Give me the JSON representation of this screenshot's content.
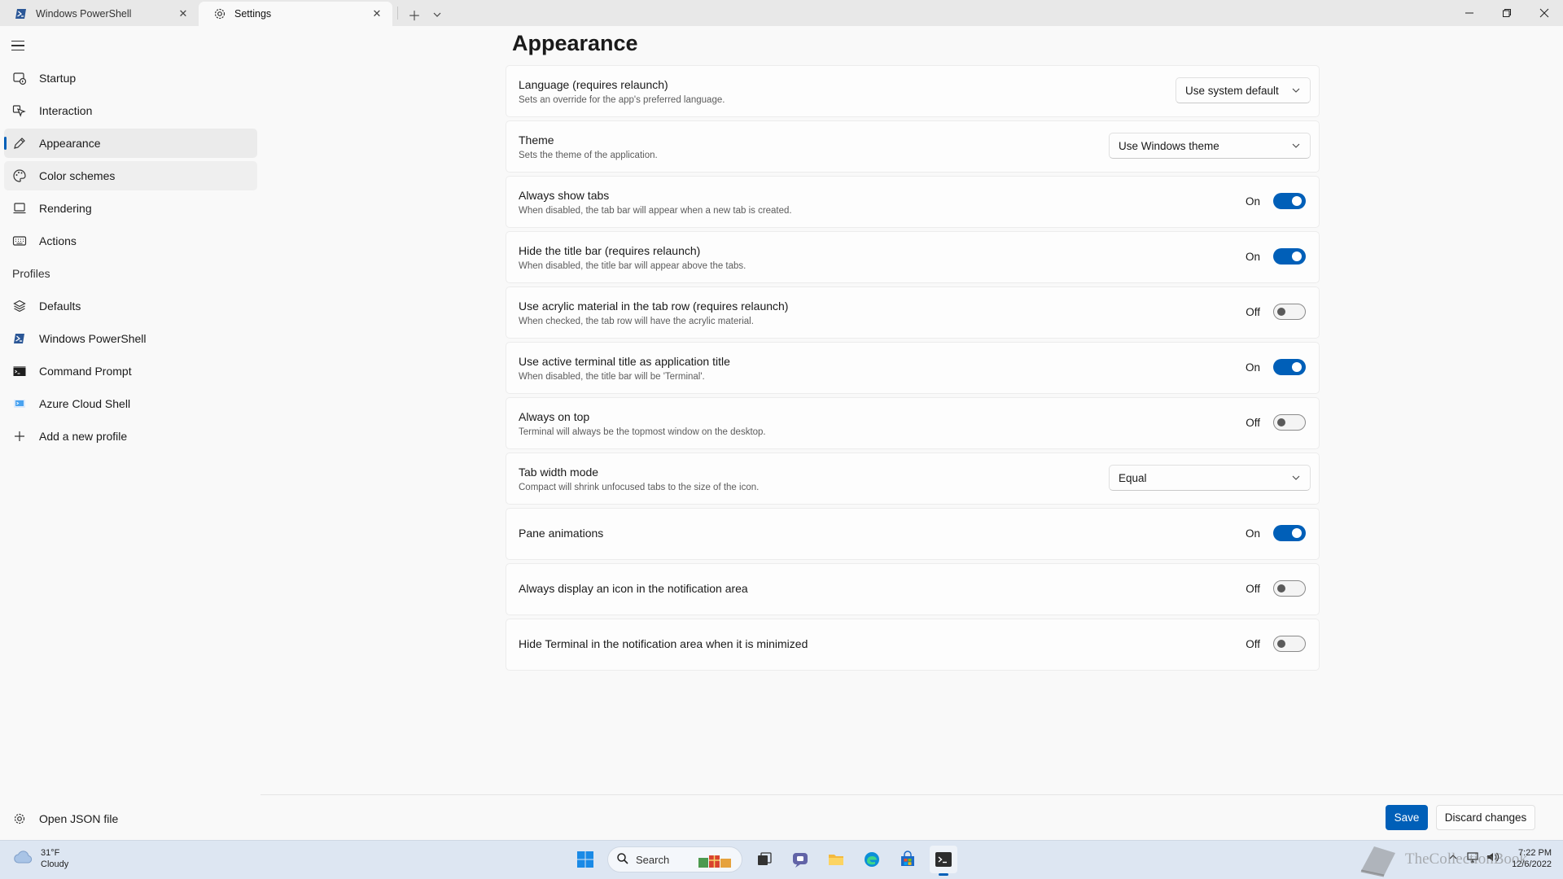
{
  "titlebar": {
    "tabs": [
      {
        "label": "Windows PowerShell",
        "icon": "powershell-icon"
      },
      {
        "label": "Settings",
        "icon": "gear-icon"
      }
    ],
    "new_tab_icon": "plus-icon",
    "dropdown_icon": "chevron-down-icon"
  },
  "sidebar": {
    "items": [
      {
        "label": "Startup",
        "icon": "startup-icon"
      },
      {
        "label": "Interaction",
        "icon": "pointer-icon"
      },
      {
        "label": "Appearance",
        "icon": "pen-icon"
      },
      {
        "label": "Color schemes",
        "icon": "palette-icon"
      },
      {
        "label": "Rendering",
        "icon": "monitor-icon"
      },
      {
        "label": "Actions",
        "icon": "keyboard-icon"
      }
    ],
    "profiles_label": "Profiles",
    "profiles": [
      {
        "label": "Defaults",
        "icon": "layers-icon"
      },
      {
        "label": "Windows PowerShell",
        "icon": "powershell-icon"
      },
      {
        "label": "Command Prompt",
        "icon": "cmd-icon"
      },
      {
        "label": "Azure Cloud Shell",
        "icon": "azure-icon"
      },
      {
        "label": "Add a new profile",
        "icon": "plus-icon"
      }
    ],
    "open_json": "Open JSON file"
  },
  "main": {
    "title": "Appearance",
    "settings": [
      {
        "title": "Language (requires relaunch)",
        "desc": "Sets an override for the app's preferred language.",
        "type": "dropdown",
        "value": "Use system default"
      },
      {
        "title": "Theme",
        "desc": "Sets the theme of the application.",
        "type": "dropdown",
        "value": "Use Windows theme"
      },
      {
        "title": "Always show tabs",
        "desc": "When disabled, the tab bar will appear when a new tab is created.",
        "type": "toggle",
        "value": "On"
      },
      {
        "title": "Hide the title bar (requires relaunch)",
        "desc": "When disabled, the title bar will appear above the tabs.",
        "type": "toggle",
        "value": "On"
      },
      {
        "title": "Use acrylic material in the tab row (requires relaunch)",
        "desc": "When checked, the tab row will have the acrylic material.",
        "type": "toggle",
        "value": "Off"
      },
      {
        "title": "Use active terminal title as application title",
        "desc": "When disabled, the title bar will be 'Terminal'.",
        "type": "toggle",
        "value": "On"
      },
      {
        "title": "Always on top",
        "desc": "Terminal will always be the topmost window on the desktop.",
        "type": "toggle",
        "value": "Off"
      },
      {
        "title": "Tab width mode",
        "desc": "Compact will shrink unfocused tabs to the size of the icon.",
        "type": "dropdown",
        "value": "Equal"
      },
      {
        "title": "Pane animations",
        "desc": "",
        "type": "toggle",
        "value": "On"
      },
      {
        "title": "Always display an icon in the notification area",
        "desc": "",
        "type": "toggle",
        "value": "Off"
      },
      {
        "title": "Hide Terminal in the notification area when it is minimized",
        "desc": "",
        "type": "toggle",
        "value": "Off"
      }
    ],
    "save_label": "Save",
    "discard_label": "Discard changes"
  },
  "taskbar": {
    "weather_temp": "31°F",
    "weather_desc": "Cloudy",
    "search_placeholder": "Search",
    "time": "7:22 PM",
    "date": "12/6/2022",
    "watermark": "TheCollectionBook"
  },
  "colors": {
    "accent": "#005fb8",
    "background": "#f9f9f9",
    "card": "#fdfdfd"
  }
}
